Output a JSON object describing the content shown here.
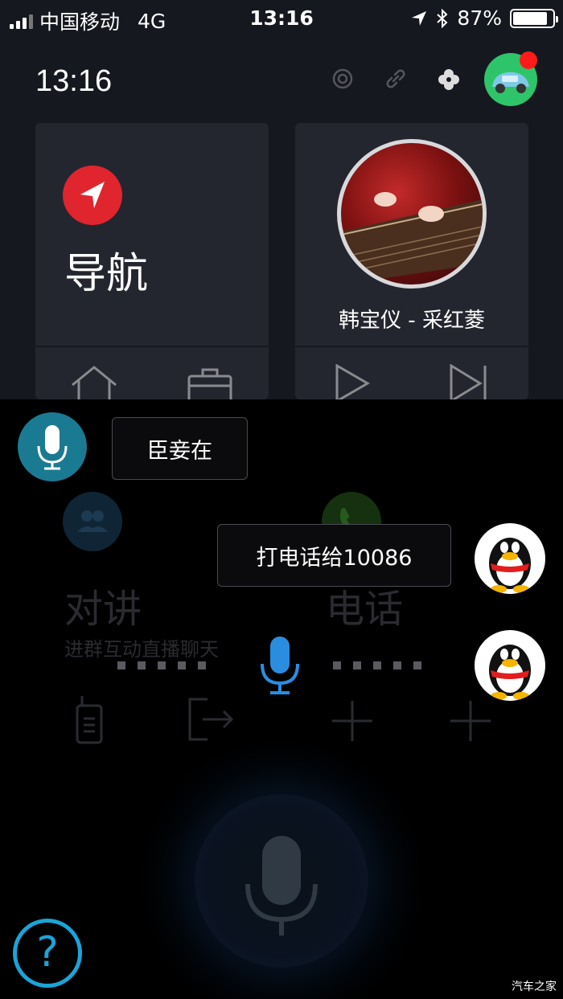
{
  "status_bar": {
    "carrier": "中国移动",
    "network": "4G",
    "time": "13:16",
    "battery": "87%",
    "battery_level": 0.87
  },
  "header": {
    "clock": "13:16",
    "icons": [
      "target-icon",
      "link-icon",
      "fan-icon"
    ],
    "avatar_icon": "car-avatar-icon"
  },
  "cards": {
    "navigation": {
      "title": "导航",
      "icons": [
        "home-icon",
        "briefcase-icon"
      ]
    },
    "music": {
      "track": "韩宝仪 - 采红菱",
      "icons": [
        "play-icon",
        "next-icon"
      ]
    }
  },
  "background_ghost": {
    "walkie_title": "对讲",
    "walkie_subtitle": "进群互动直播聊天",
    "phone_title": "电话"
  },
  "conversation": {
    "assistant_reply": "臣妾在",
    "user_command": "打电话给10086"
  },
  "watermark": "汽车之家",
  "colors": {
    "nav_red": "#e0252f",
    "assistant_teal": "#1a7a92",
    "voice_blue": "#2a8de0",
    "help_blue": "#1ba4d8"
  }
}
